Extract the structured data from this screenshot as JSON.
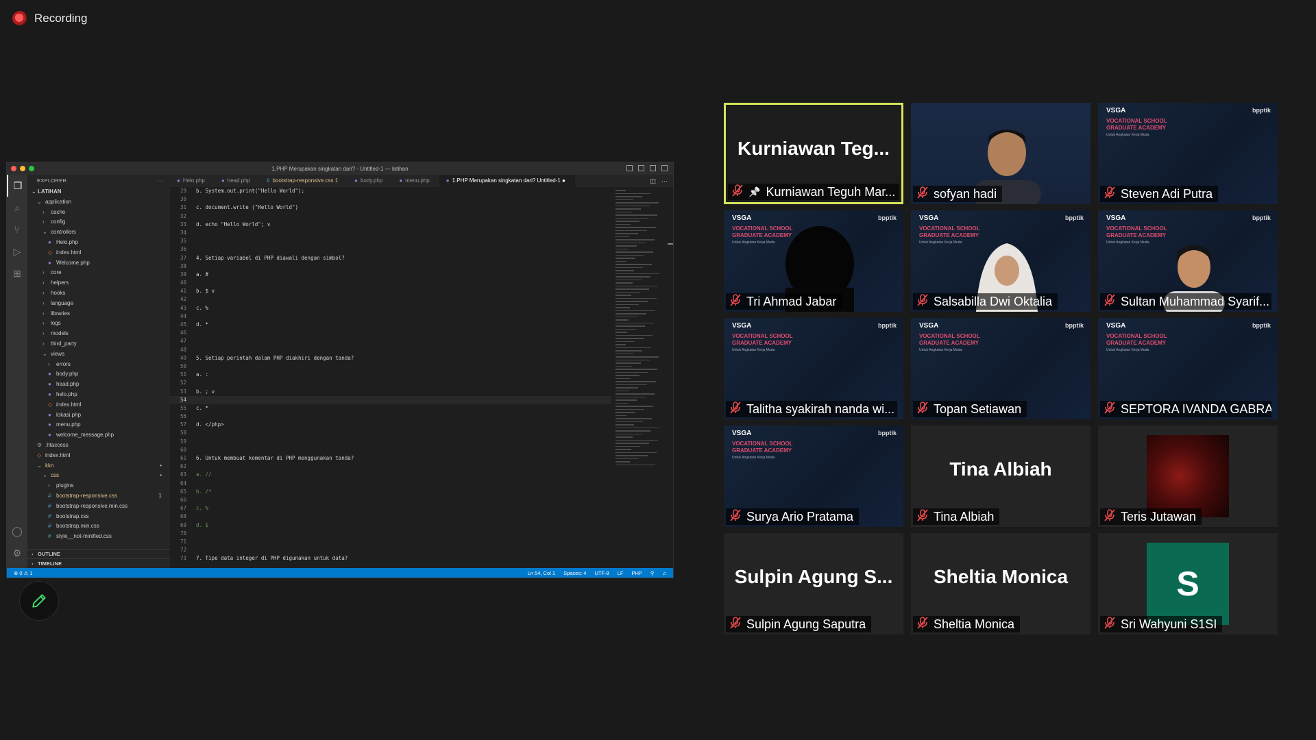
{
  "recording": {
    "label": "Recording"
  },
  "share": {
    "window_title": "1.PHP Merupakan singkatan dari? - Untitled-1 — latihan",
    "explorer": {
      "header": "EXPLORER",
      "root": "LATIHAN",
      "items": [
        {
          "label": "application",
          "depth": 1,
          "kind": "folder-open"
        },
        {
          "label": "cache",
          "depth": 2,
          "kind": "folder"
        },
        {
          "label": "config",
          "depth": 2,
          "kind": "folder"
        },
        {
          "label": "controllers",
          "depth": 2,
          "kind": "folder-open"
        },
        {
          "label": "Helo.php",
          "depth": 3,
          "kind": "php"
        },
        {
          "label": "index.html",
          "depth": 3,
          "kind": "html"
        },
        {
          "label": "Welcome.php",
          "depth": 3,
          "kind": "php"
        },
        {
          "label": "core",
          "depth": 2,
          "kind": "folder"
        },
        {
          "label": "helpers",
          "depth": 2,
          "kind": "folder"
        },
        {
          "label": "hooks",
          "depth": 2,
          "kind": "folder"
        },
        {
          "label": "language",
          "depth": 2,
          "kind": "folder"
        },
        {
          "label": "libraries",
          "depth": 2,
          "kind": "folder"
        },
        {
          "label": "logs",
          "depth": 2,
          "kind": "folder"
        },
        {
          "label": "models",
          "depth": 2,
          "kind": "folder"
        },
        {
          "label": "third_party",
          "depth": 2,
          "kind": "folder"
        },
        {
          "label": "views",
          "depth": 2,
          "kind": "folder-open"
        },
        {
          "label": "errors",
          "depth": 3,
          "kind": "folder"
        },
        {
          "label": "body.php",
          "depth": 3,
          "kind": "php"
        },
        {
          "label": "head.php",
          "depth": 3,
          "kind": "php"
        },
        {
          "label": "helo.php",
          "depth": 3,
          "kind": "php"
        },
        {
          "label": "index.html",
          "depth": 3,
          "kind": "html"
        },
        {
          "label": "lokasi.php",
          "depth": 3,
          "kind": "php"
        },
        {
          "label": "menu.php",
          "depth": 3,
          "kind": "php"
        },
        {
          "label": "welcome_message.php",
          "depth": 3,
          "kind": "php"
        },
        {
          "label": ".htaccess",
          "depth": 1,
          "kind": "gear"
        },
        {
          "label": "index.html",
          "depth": 1,
          "kind": "html"
        },
        {
          "label": "kkn",
          "depth": 1,
          "kind": "folder-open",
          "modified": true
        },
        {
          "label": "css",
          "depth": 2,
          "kind": "folder-open",
          "modified": true
        },
        {
          "label": "plugins",
          "depth": 3,
          "kind": "folder"
        },
        {
          "label": "bootstrap-responsive.css",
          "depth": 3,
          "kind": "css",
          "modified": true,
          "badge": "1"
        },
        {
          "label": "bootstrap-responsive.min.css",
          "depth": 3,
          "kind": "css"
        },
        {
          "label": "bootstrap.css",
          "depth": 3,
          "kind": "css"
        },
        {
          "label": "bootstrap.min.css",
          "depth": 3,
          "kind": "css"
        },
        {
          "label": "style__not-minified.css",
          "depth": 3,
          "kind": "css"
        }
      ],
      "outline": "OUTLINE",
      "timeline": "TIMELINE"
    },
    "tabs": [
      {
        "label": "Helo.php",
        "active": false
      },
      {
        "label": "head.php",
        "active": false
      },
      {
        "label": "bootstrap-responsive.css 1",
        "active": false,
        "modified": true
      },
      {
        "label": "body.php",
        "active": false
      },
      {
        "label": "menu.php",
        "active": false
      },
      {
        "label": "1.PHP Merupakan singkatan dari? Untitled-1",
        "active": true
      }
    ],
    "code_lines": [
      {
        "n": "29",
        "t": "b. System.out.print(\"Hello World\");"
      },
      {
        "n": "30",
        "t": ""
      },
      {
        "n": "31",
        "t": "c. document.write (\"Hello World\")"
      },
      {
        "n": "32",
        "t": ""
      },
      {
        "n": "33",
        "t": "d. echo \"Hello World\"; v"
      },
      {
        "n": "34",
        "t": ""
      },
      {
        "n": "35",
        "t": ""
      },
      {
        "n": "36",
        "t": ""
      },
      {
        "n": "37",
        "t": "4. Setiap variabel di PHP diawali dengan simbol?"
      },
      {
        "n": "38",
        "t": ""
      },
      {
        "n": "39",
        "t": "a. #"
      },
      {
        "n": "40",
        "t": ""
      },
      {
        "n": "41",
        "t": "b. $ v"
      },
      {
        "n": "42",
        "t": ""
      },
      {
        "n": "43",
        "t": "c. %"
      },
      {
        "n": "44",
        "t": ""
      },
      {
        "n": "45",
        "t": "d. *"
      },
      {
        "n": "46",
        "t": ""
      },
      {
        "n": "47",
        "t": ""
      },
      {
        "n": "48",
        "t": ""
      },
      {
        "n": "49",
        "t": "5. Setiap perintah dalam PHP diakhiri dengan tanda?"
      },
      {
        "n": "50",
        "t": ""
      },
      {
        "n": "51",
        "t": "a. :"
      },
      {
        "n": "52",
        "t": ""
      },
      {
        "n": "53",
        "t": "b. ; v"
      },
      {
        "n": "54",
        "t": "",
        "cur": true
      },
      {
        "n": "55",
        "t": "c. *"
      },
      {
        "n": "56",
        "t": ""
      },
      {
        "n": "57",
        "t": "d. </php>"
      },
      {
        "n": "58",
        "t": ""
      },
      {
        "n": "59",
        "t": ""
      },
      {
        "n": "60",
        "t": ""
      },
      {
        "n": "61",
        "t": "6. Untuk membuat komentar di PHP menggunakan tanda?"
      },
      {
        "n": "62",
        "t": ""
      },
      {
        "n": "63",
        "t": "a. //",
        "com": true
      },
      {
        "n": "64",
        "t": ""
      },
      {
        "n": "65",
        "t": "b. /*",
        "com": true
      },
      {
        "n": "66",
        "t": ""
      },
      {
        "n": "67",
        "t": "c. %",
        "com": true
      },
      {
        "n": "68",
        "t": ""
      },
      {
        "n": "69",
        "t": "d. $",
        "com": true
      },
      {
        "n": "70",
        "t": ""
      },
      {
        "n": "71",
        "t": ""
      },
      {
        "n": "72",
        "t": ""
      },
      {
        "n": "73",
        "t": "7. Tipe data integer di PHP digunakan untuk data?"
      }
    ],
    "status": {
      "problems": "⊗ 0 ⚠ 1",
      "position": "Ln 54, Col 1",
      "spaces": "Spaces: 4",
      "encoding": "UTF-8",
      "eol": "LF",
      "language": "PHP"
    }
  },
  "participants": [
    {
      "name": "Kurniawan Teguh Mar...",
      "display": "Kurniawan  Teg...",
      "type": "name",
      "pinned": true,
      "speaking": true
    },
    {
      "name": "sofyan hadi",
      "type": "video-person"
    },
    {
      "name": "Steven Adi Putra",
      "type": "banner"
    },
    {
      "name": "Tri Ahmad Jabar",
      "type": "banner-person-dark"
    },
    {
      "name": "Salsabilla Dwi Oktalia",
      "type": "banner-person-hijab"
    },
    {
      "name": "Sultan Muhammad Syarif...",
      "type": "banner-person"
    },
    {
      "name": "Talitha syakirah nanda wi...",
      "type": "banner"
    },
    {
      "name": "Topan Setiawan",
      "type": "banner"
    },
    {
      "name": "SEPTORA IVANDA GABRA...",
      "type": "banner"
    },
    {
      "name": "Surya Ario Pratama",
      "type": "banner"
    },
    {
      "name": "Tina Albiah",
      "display": "Tina Albiah",
      "type": "name"
    },
    {
      "name": "Teris Jutawan",
      "type": "photo"
    },
    {
      "name": "Sulpin Agung Saputra",
      "display": "Sulpin Agung S...",
      "type": "name"
    },
    {
      "name": "Sheltia Monica",
      "display": "Sheltia Monica",
      "type": "name"
    },
    {
      "name": "Sri Wahyuni S1SI",
      "type": "letter",
      "letter": "S"
    }
  ],
  "banner_text": {
    "brand": "VSGA",
    "title_line1": "VOCATIONAL SCHOOL",
    "title_line2": "GRADUATE ACADEMY",
    "sub": "Untuk Angkatan Kerja Muda",
    "logo": "bpptik"
  },
  "colors": {
    "speaking_border": "#d6e35a",
    "mic_off": "#e5484d",
    "status_bar": "#007acc",
    "avatar_s": "#0a6b52"
  }
}
